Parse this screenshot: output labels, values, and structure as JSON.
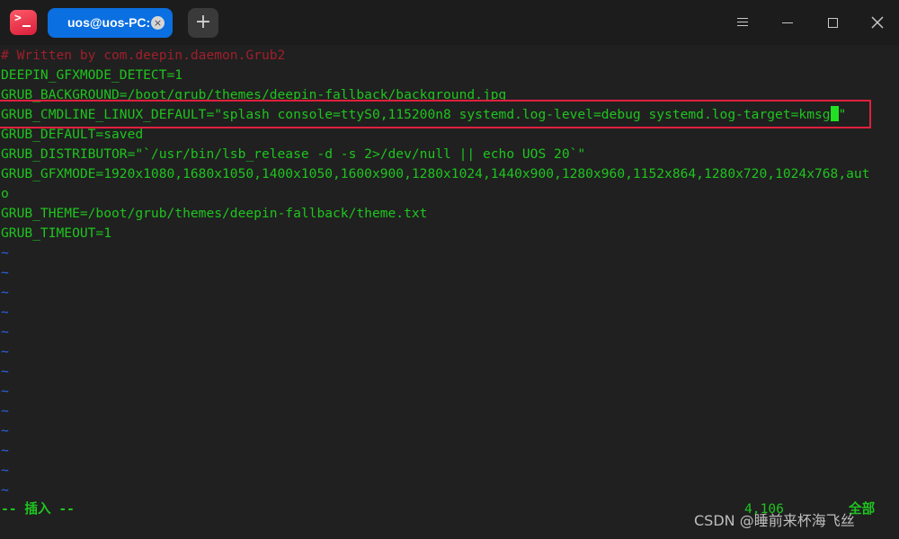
{
  "titlebar": {
    "app_icon": "terminal-prompt-icon",
    "tab": {
      "label": "uos@uos-PC: ~",
      "close_glyph": "×"
    },
    "new_tab_glyph": "+",
    "window_controls": [
      "menu-icon",
      "minimize-icon",
      "maximize-icon",
      "close-icon"
    ]
  },
  "editor": {
    "lines": [
      {
        "text": "# Written by com.deepin.daemon.Grub2",
        "kind": "comment"
      },
      {
        "text": "DEEPIN_GFXMODE_DETECT=1",
        "kind": "text"
      },
      {
        "text": "GRUB_BACKGROUND=/boot/grub/themes/deepin-fallback/background.jpg",
        "kind": "text"
      },
      {
        "text_before_cursor": "GRUB_CMDLINE_LINUX_DEFAULT=\"splash console=ttyS0,115200n8 systemd.log-level=debug systemd.log-target=kmsg",
        "text_after_cursor": "\"",
        "kind": "text"
      },
      {
        "text": "GRUB_DEFAULT=saved",
        "kind": "text"
      },
      {
        "text": "GRUB_DISTRIBUTOR=\"`/usr/bin/lsb_release -d -s 2>/dev/null || echo UOS 20`\"",
        "kind": "text"
      },
      {
        "text": "GRUB_GFXMODE=1920x1080,1680x1050,1400x1050,1600x900,1280x1024,1440x900,1280x960,1152x864,1280x720,1024x768,aut",
        "kind": "text"
      },
      {
        "text": "o",
        "kind": "text"
      },
      {
        "text": "GRUB_THEME=/boot/grub/themes/deepin-fallback/theme.txt",
        "kind": "text"
      },
      {
        "text": "GRUB_TIMEOUT=1",
        "kind": "text"
      }
    ],
    "tilde": "~",
    "tilde_count": 13
  },
  "statusbar": {
    "mode": "-- 插入 --",
    "position": "4,106",
    "scroll": "全部"
  },
  "watermark": "CSDN @睡前来杯海飞丝",
  "colors": {
    "text_green": "#1ec51e",
    "comment_red": "#a01f2c",
    "tilde_blue": "#2c62e8",
    "highlight_red": "#e0203e",
    "tab_blue": "#0a6fe0",
    "background": "#202020"
  }
}
